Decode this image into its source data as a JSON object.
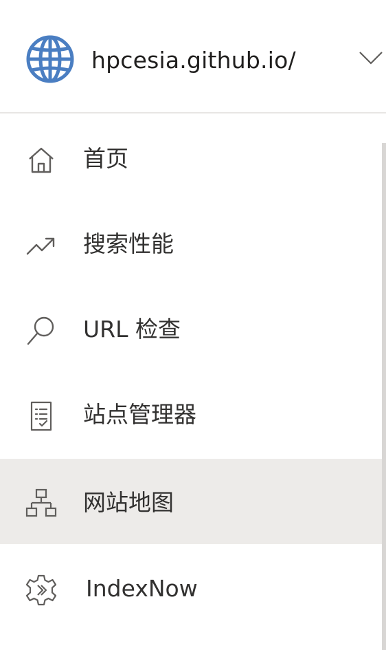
{
  "site": {
    "name": "hpcesia.github.io/",
    "icon": "globe-icon",
    "dropdown_icon": "chevron-down-icon",
    "icon_color": "#4a7ec2"
  },
  "nav": {
    "items": [
      {
        "label": "首页",
        "icon": "home-icon",
        "selected": false
      },
      {
        "label": "搜索性能",
        "icon": "trending-up-icon",
        "selected": false
      },
      {
        "label": "URL 检查",
        "icon": "search-icon",
        "selected": false
      },
      {
        "label": "站点管理器",
        "icon": "checklist-icon",
        "selected": false
      },
      {
        "label": "网站地图",
        "icon": "sitemap-icon",
        "selected": true
      },
      {
        "label": "IndexNow",
        "icon": "indexnow-gear-icon",
        "selected": false
      }
    ]
  },
  "colors": {
    "selected_bg": "#edebe9",
    "text": "#323130",
    "icon": "#605e5c",
    "divider": "#e8e6e4"
  }
}
